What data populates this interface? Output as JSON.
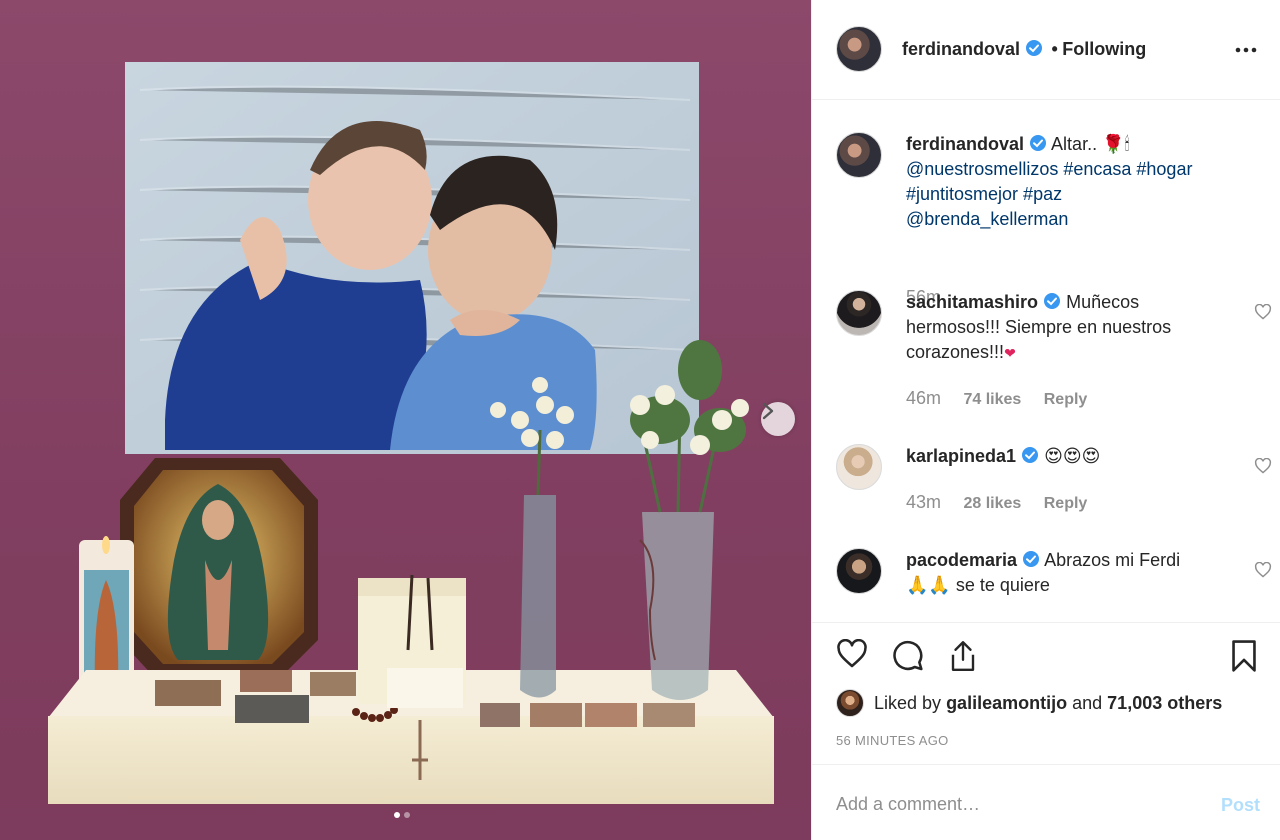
{
  "header": {
    "username": "ferdinandoval",
    "separator": "•",
    "follow_status": "Following"
  },
  "caption": {
    "username": "ferdinandoval",
    "text": "Altar..",
    "emoji": "🌹🕯",
    "mention1": "@nuestrosmellizos",
    "tags1": "#encasa #hogar",
    "tags2": "#juntitosmejor #paz",
    "mention2": "@brenda_kellerman",
    "time": "56m"
  },
  "comments": [
    {
      "username": "sachitamashiro",
      "line1": "Muñecos",
      "line2": "hermosos!!! Siempre en nuestros",
      "line3": "corazones!!!",
      "emoji": "❤",
      "time": "46m",
      "likes": "74 likes",
      "reply": "Reply"
    },
    {
      "username": "karlapineda1",
      "emoji": "😍😍😍",
      "time": "43m",
      "likes": "28 likes",
      "reply": "Reply"
    },
    {
      "username": "pacodemaria",
      "line1": "Abrazos mi Ferdi",
      "emoji": "🙏🙏",
      "line2": "se te quiere"
    }
  ],
  "likes": {
    "prefix": "Liked by",
    "user": "galileamontijo",
    "middle": "and",
    "count": "71,003 others"
  },
  "post_age": "56 MINUTES AGO",
  "add_comment": {
    "placeholder": "Add a comment…",
    "post_label": "Post"
  },
  "carousel": {
    "slides": 2,
    "active": 0
  },
  "icons": {
    "heart": "heart-icon",
    "comment": "comment-icon",
    "share": "share-icon",
    "save": "bookmark-icon",
    "more": "more-dots-icon",
    "next": "chevron-right-icon",
    "verified": "verified-badge-icon"
  },
  "colors": {
    "link": "#00376b",
    "verified": "#3897f0",
    "muted": "#8e8e8e",
    "post_disabled": "#b2dffc",
    "wall": "#8d4a6b"
  }
}
